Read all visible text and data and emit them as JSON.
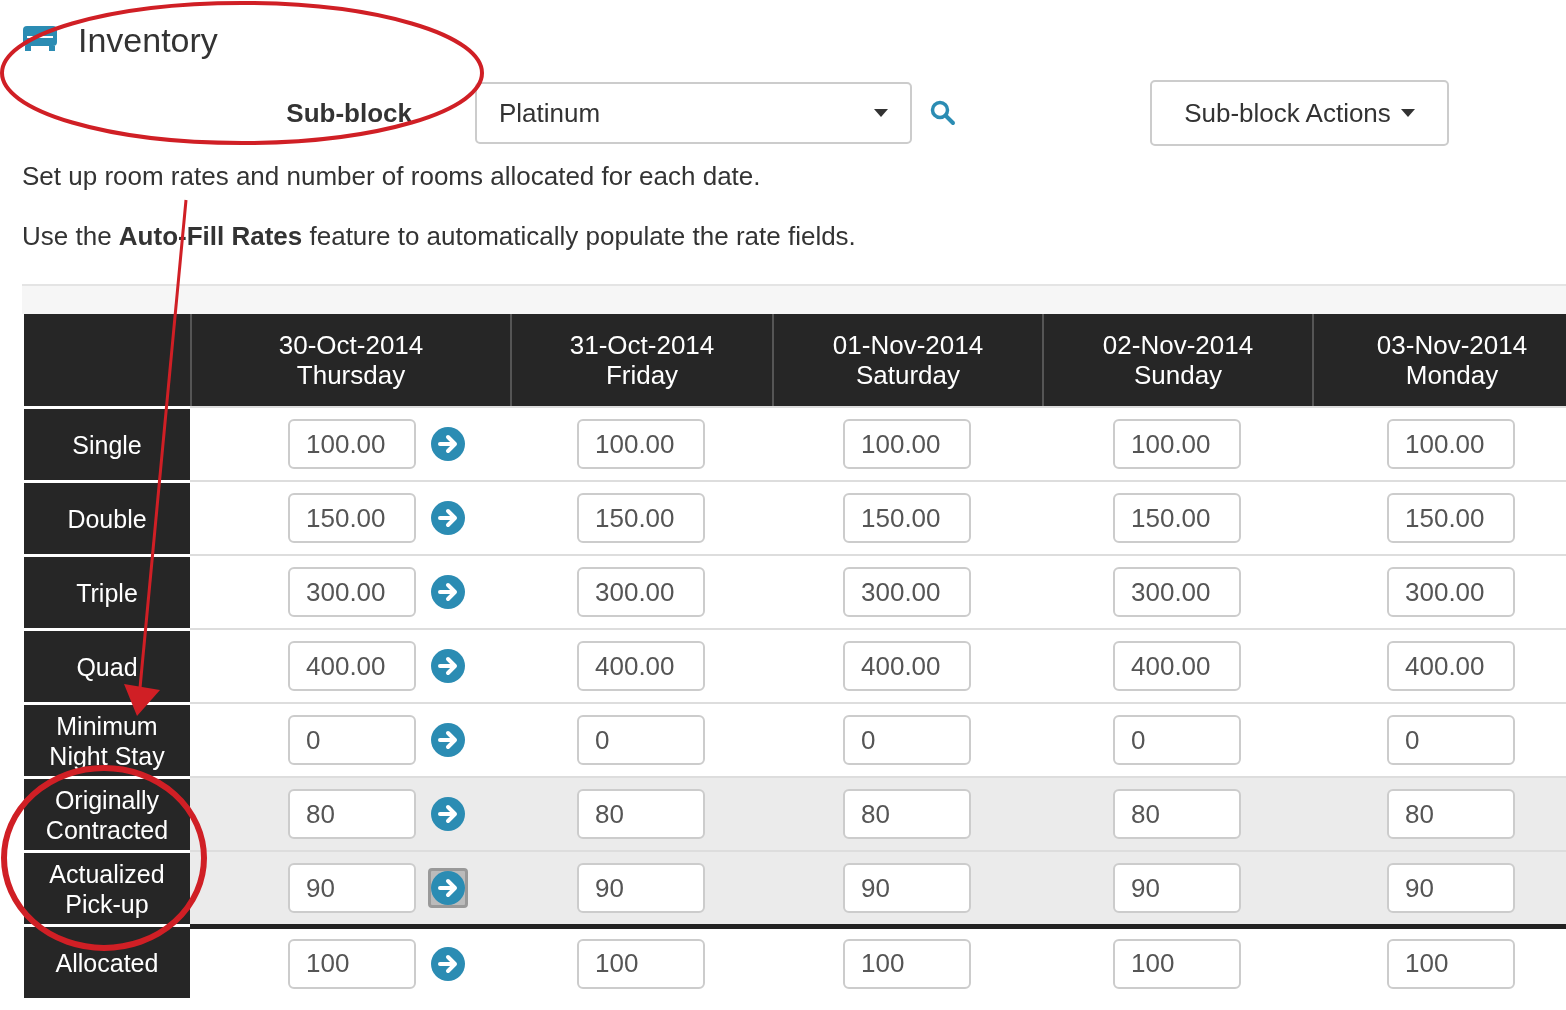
{
  "header": {
    "title": "Inventory"
  },
  "subblock": {
    "label": "Sub-block",
    "value": "Platinum",
    "actions_button": "Sub-block Actions"
  },
  "intro": [
    "Set up room rates and number of rooms allocated for each date.",
    "Use the **Auto-Fill Rates** feature to automatically populate the rate fields."
  ],
  "table": {
    "columns": [
      {
        "date": "30-Oct-2014",
        "day": "Thursday"
      },
      {
        "date": "31-Oct-2014",
        "day": "Friday"
      },
      {
        "date": "01-Nov-2014",
        "day": "Saturday"
      },
      {
        "date": "02-Nov-2014",
        "day": "Sunday"
      },
      {
        "date": "03-Nov-2014",
        "day": "Monday"
      }
    ],
    "rows": [
      {
        "label": "Single",
        "shaded": false,
        "autofill_focused": false,
        "values": [
          "100.00",
          "100.00",
          "100.00",
          "100.00",
          "100.00"
        ]
      },
      {
        "label": "Double",
        "shaded": false,
        "autofill_focused": false,
        "values": [
          "150.00",
          "150.00",
          "150.00",
          "150.00",
          "150.00"
        ]
      },
      {
        "label": "Triple",
        "shaded": false,
        "autofill_focused": false,
        "values": [
          "300.00",
          "300.00",
          "300.00",
          "300.00",
          "300.00"
        ]
      },
      {
        "label": "Quad",
        "shaded": false,
        "autofill_focused": false,
        "values": [
          "400.00",
          "400.00",
          "400.00",
          "400.00",
          "400.00"
        ]
      },
      {
        "label": "Minimum Night Stay",
        "shaded": false,
        "autofill_focused": false,
        "values": [
          "0",
          "0",
          "0",
          "0",
          "0"
        ]
      },
      {
        "label": "Originally Contracted",
        "shaded": true,
        "autofill_focused": false,
        "values": [
          "80",
          "80",
          "80",
          "80",
          "80"
        ]
      },
      {
        "label": "Actualized Pick-up",
        "shaded": true,
        "autofill_focused": true,
        "values": [
          "90",
          "90",
          "90",
          "90",
          "90"
        ]
      },
      {
        "label": "Allocated",
        "shaded": false,
        "autofill_focused": false,
        "values": [
          "100",
          "100",
          "100",
          "100",
          "100"
        ]
      }
    ]
  }
}
